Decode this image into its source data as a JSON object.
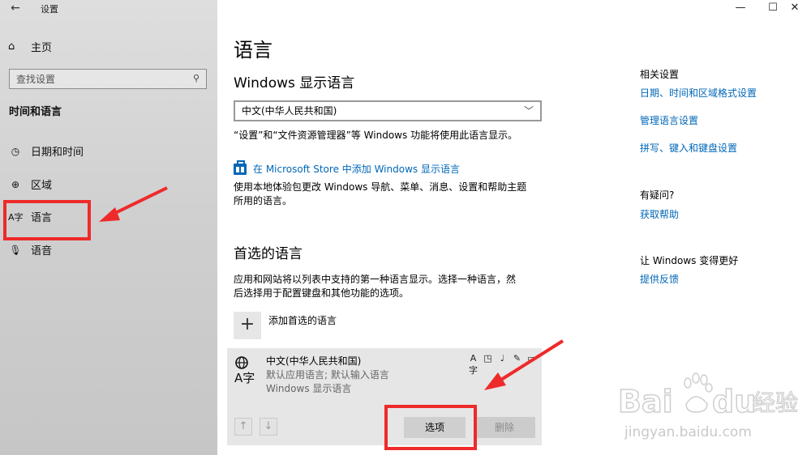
{
  "window": {
    "app_title": "设置",
    "back": "←",
    "minimize": "—",
    "maximize": "☐",
    "close": "✕"
  },
  "sidebar": {
    "home": "主页",
    "search_placeholder": "查找设置",
    "section_title": "时间和语言",
    "items": [
      {
        "label": "日期和时间"
      },
      {
        "label": "区域"
      },
      {
        "label": "语言"
      },
      {
        "label": "语音"
      }
    ]
  },
  "main": {
    "title": "语言",
    "display_language": {
      "heading": "Windows 显示语言",
      "selected": "中文(中华人民共和国)",
      "note": "“设置”和“文件资源管理器”等 Windows 功能将使用此语言显示。",
      "store_link": "在 Microsoft Store 中添加 Windows 显示语言",
      "store_note_1": "使用本地体验包更改 Windows 导航、菜单、消息、设置和帮助主题",
      "store_note_2": "所用的语言。"
    },
    "preferred": {
      "heading": "首选的语言",
      "desc_1": "应用和网站将以列表中支持的第一种语言显示。选择一种语言，然",
      "desc_2": "后选择用于配置键盘和其他功能的选项。",
      "add_label": "添加首选的语言",
      "language": {
        "name": "中文(中华人民共和国)",
        "line1": "默认应用语言; 默认输入语言",
        "line2": "Windows 显示语言"
      },
      "options_button": "选项",
      "remove_button": "删除"
    }
  },
  "related": {
    "heading": "相关设置",
    "links": [
      "日期、时间和区域格式设置",
      "管理语言设置",
      "拼写、键入和键盘设置"
    ],
    "help_heading": "有疑问?",
    "help_link": "获取帮助",
    "better_heading": "让 Windows 变得更好",
    "feedback_link": "提供反馈"
  },
  "watermark": {
    "brand": "Bai",
    "brand2": "du",
    "cn": "经验",
    "url": "jingyan.baidu.com"
  },
  "colors": {
    "accent": "#0067b8",
    "annotation": "#ee2a2a"
  }
}
